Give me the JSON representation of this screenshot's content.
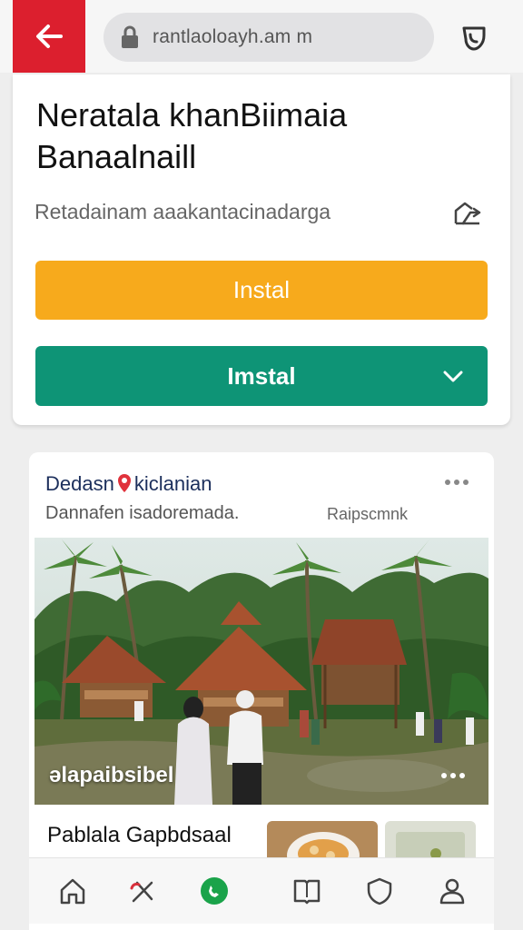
{
  "browser": {
    "url": "rantlaoloayh.am m",
    "icons": {
      "back": "arrow-left-icon",
      "lock": "lock-icon",
      "tabs": "tabs-icon"
    },
    "back_color": "#dc1f2e"
  },
  "app": {
    "title_line1": "Neratala khanBiimaia",
    "title_line2": "Banaalnaill",
    "subtitle": "Retadainam aaakan​tacinadarga",
    "share_icon": "share-icon",
    "install_primary_label": "Instal",
    "install_secondary_label": "Imstal",
    "colors": {
      "primary": "#f7aa1c",
      "secondary": "#0e9476"
    }
  },
  "post": {
    "author_prefix": "Dedasn",
    "author_suffix": "kiclanian",
    "description": "Dannafen isadoremada.",
    "tag": "Raipscmnk",
    "photo_label": "əlapaibsibel",
    "title": "Pablala Gapbdsaal"
  },
  "nav": {
    "items": [
      "home-icon",
      "tools-icon",
      "whatsapp-icon",
      "book-icon",
      "shield-icon",
      "profile-icon"
    ],
    "active_color": "#1aa34a"
  }
}
